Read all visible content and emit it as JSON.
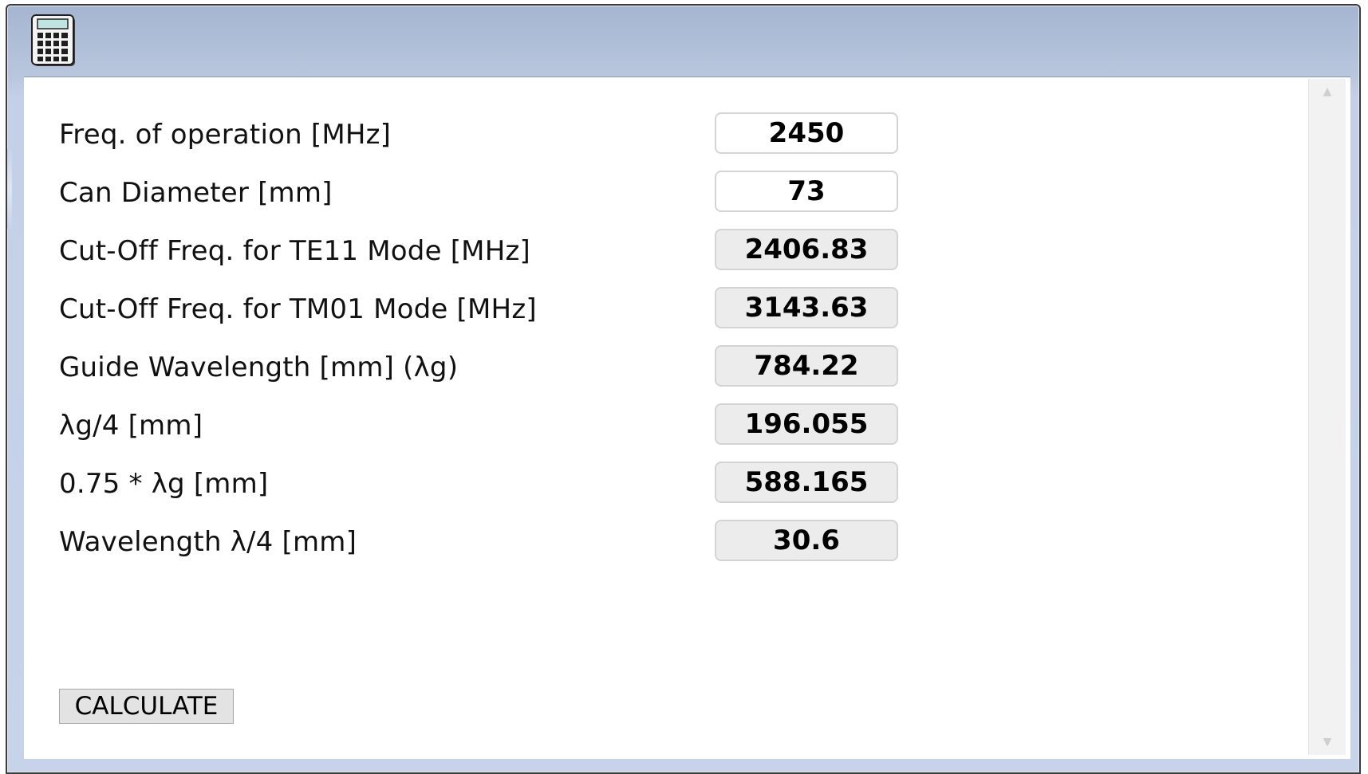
{
  "window": {
    "icon": "calculator-icon"
  },
  "form": {
    "rows": [
      {
        "label": "Freq. of operation [MHz]",
        "value": "2450",
        "editable": true
      },
      {
        "label": "Can Diameter [mm]",
        "value": "73",
        "editable": true
      },
      {
        "label": "Cut-Off Freq. for TE11 Mode [MHz]",
        "value": "2406.83",
        "editable": false
      },
      {
        "label": "Cut-Off Freq. for TM01 Mode [MHz]",
        "value": "3143.63",
        "editable": false
      },
      {
        "label": "Guide Wavelength [mm] (λg)",
        "value": "784.22",
        "editable": false
      },
      {
        "label": "λg/4 [mm]",
        "value": "196.055",
        "editable": false
      },
      {
        "label": "0.75 * λg [mm]",
        "value": "588.165",
        "editable": false
      },
      {
        "label": "Wavelength λ/4 [mm]",
        "value": "30.6",
        "editable": false
      }
    ]
  },
  "actions": {
    "calculate_label": "CALCULATE"
  },
  "colors": {
    "title_bar": "#b8c6dd",
    "readonly_field": "#ececec",
    "button": "#e3e3e3"
  }
}
